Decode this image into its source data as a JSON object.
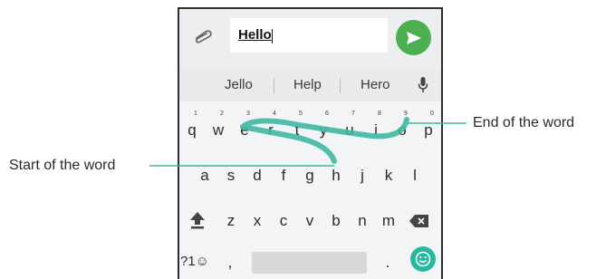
{
  "input": {
    "value": "Hello"
  },
  "icons": {
    "attach": "paperclip-icon",
    "send": "send-arrow-icon",
    "mic": "microphone-icon",
    "shift": "shift-arrow-icon",
    "backspace": "backspace-icon",
    "emoji": "smiley-icon"
  },
  "suggestions": [
    "Jello",
    "Help",
    "Hero"
  ],
  "keyboard": {
    "row1": [
      "q",
      "w",
      "e",
      "r",
      "t",
      "y",
      "u",
      "i",
      "o",
      "p"
    ],
    "row1_hints": [
      "1",
      "2",
      "3",
      "4",
      "5",
      "6",
      "7",
      "8",
      "9",
      "0"
    ],
    "row2": [
      "a",
      "s",
      "d",
      "f",
      "g",
      "h",
      "j",
      "k",
      "l"
    ],
    "row3": [
      "z",
      "x",
      "c",
      "v",
      "b",
      "n",
      "m"
    ],
    "symbols_key": "?1☺",
    "comma_key": ",",
    "period_key": "."
  },
  "annotations": {
    "start": "Start of the word",
    "end": "End of the word"
  },
  "colors": {
    "swipe_trail": "#3fb8a4",
    "send_button": "#4caf50",
    "emoji_button": "#27b99f"
  }
}
